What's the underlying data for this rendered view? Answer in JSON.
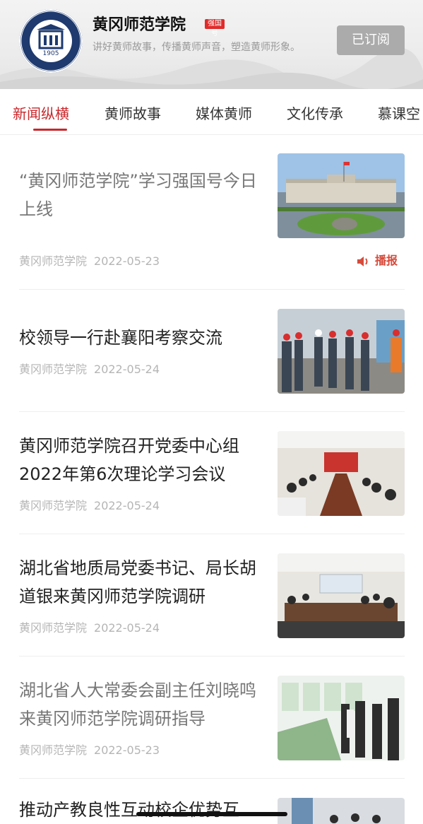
{
  "header": {
    "title": "黄冈师范学院",
    "badge": "强国号",
    "slogan": "讲好黄师故事，传播黄师声音，塑造黄师形象。",
    "subscribe_label": "已订阅",
    "logo_year": "1905",
    "logo_text": "HUANGGANG NORMAL UNIVERSITY"
  },
  "tabs": [
    {
      "label": "新闻纵横",
      "active": true
    },
    {
      "label": "黄师故事",
      "active": false
    },
    {
      "label": "媒体黄师",
      "active": false
    },
    {
      "label": "文化传承",
      "active": false
    },
    {
      "label": "慕课空",
      "active": false
    }
  ],
  "broadcast_label": "播报",
  "articles": [
    {
      "title": "“黄冈师范学院”学习强国号今日上线",
      "source": "黄冈师范学院",
      "date": "2022-05-23",
      "read": true,
      "image": "campus-building"
    },
    {
      "title": "校领导一行赴襄阳考察交流",
      "source": "黄冈师范学院",
      "date": "2022-05-24",
      "read": false,
      "image": "site-visit"
    },
    {
      "title": "黄冈师范学院召开党委中心组2022年第6次理论学习会议",
      "source": "黄冈师范学院",
      "date": "2022-05-24",
      "read": false,
      "image": "meeting-room"
    },
    {
      "title": "湖北省地质局党委书记、局长胡道银来黄冈师范学院调研",
      "source": "黄冈师范学院",
      "date": "2022-05-24",
      "read": false,
      "image": "conference-table"
    },
    {
      "title": "湖北省人大常委会副主任刘晓鸣来黄冈师范学院调研指导",
      "source": "黄冈师范学院",
      "date": "2022-05-23",
      "read": true,
      "image": "exhibition-model"
    },
    {
      "title": "推动产教良性互动校企优势互",
      "source": "",
      "date": "",
      "read": false,
      "image": "group-visit"
    }
  ]
}
